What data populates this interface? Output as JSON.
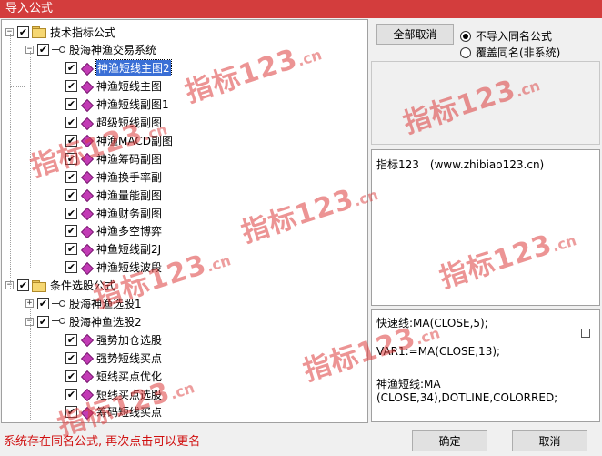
{
  "window": {
    "title": "导入公式"
  },
  "tree": {
    "items": [
      {
        "label": "技术指标公式",
        "expander": "−",
        "checked": true,
        "icon": "folder-icon",
        "selected": false
      },
      {
        "label": "股海神渔交易系统",
        "expander": "−",
        "checked": true,
        "icon": "key-icon",
        "selected": false
      },
      {
        "label": "神渔短线主图2",
        "expander": "",
        "checked": true,
        "icon": "formula-icon",
        "selected": true
      },
      {
        "label": "神渔短线主图",
        "expander": "",
        "checked": true,
        "icon": "formula-icon",
        "selected": false
      },
      {
        "label": "神渔短线副图1",
        "expander": "",
        "checked": true,
        "icon": "formula-icon",
        "selected": false
      },
      {
        "label": "超级短线副图",
        "expander": "",
        "checked": true,
        "icon": "formula-icon",
        "selected": false
      },
      {
        "label": "神渔MACD副图",
        "expander": "",
        "checked": true,
        "icon": "formula-icon",
        "selected": false
      },
      {
        "label": "神渔筹码副图",
        "expander": "",
        "checked": true,
        "icon": "formula-icon",
        "selected": false
      },
      {
        "label": "神渔换手率副",
        "expander": "",
        "checked": true,
        "icon": "formula-icon",
        "selected": false
      },
      {
        "label": "神渔量能副图",
        "expander": "",
        "checked": true,
        "icon": "formula-icon",
        "selected": false
      },
      {
        "label": "神渔财务副图",
        "expander": "",
        "checked": true,
        "icon": "formula-icon",
        "selected": false
      },
      {
        "label": "神渔多空博弈",
        "expander": "",
        "checked": true,
        "icon": "formula-icon",
        "selected": false
      },
      {
        "label": "神鱼短线副2J",
        "expander": "",
        "checked": true,
        "icon": "formula-icon",
        "selected": false
      },
      {
        "label": "神渔短线波段",
        "expander": "",
        "checked": true,
        "icon": "formula-icon",
        "selected": false
      },
      {
        "label": "条件选股公式",
        "expander": "−",
        "checked": true,
        "icon": "folder-icon",
        "selected": false
      },
      {
        "label": "股海神渔选股1",
        "expander": "+",
        "checked": true,
        "icon": "key-icon",
        "selected": false
      },
      {
        "label": "股海神鱼选股2",
        "expander": "−",
        "checked": true,
        "icon": "key-icon",
        "selected": false
      },
      {
        "label": "强势加仓选股",
        "expander": "",
        "checked": true,
        "icon": "formula-icon",
        "selected": false
      },
      {
        "label": "强势短线买点",
        "expander": "",
        "checked": true,
        "icon": "formula-icon",
        "selected": false
      },
      {
        "label": "短线买点优化",
        "expander": "",
        "checked": true,
        "icon": "formula-icon",
        "selected": false
      },
      {
        "label": "短线买点选股",
        "expander": "",
        "checked": true,
        "icon": "formula-icon",
        "selected": false
      },
      {
        "label": "筹码短线买点",
        "expander": "",
        "checked": true,
        "icon": "formula-icon",
        "selected": false
      }
    ]
  },
  "buttons": {
    "cancel_all": "全部取消",
    "ok": "确定",
    "cancel": "取消"
  },
  "options": {
    "no_import_same": "不导入同名公式",
    "overwrite_same": "覆盖同名(非系统)",
    "selected": "no_import_same"
  },
  "info": {
    "text": "指标123　(www.zhibiao123.cn)"
  },
  "code": {
    "lines": [
      "快速线:MA(CLOSE,5);",
      "VAR1:=MA(CLOSE,13);",
      "神渔短线:MA",
      "(CLOSE,34),DOTLINE,COLORRED;"
    ]
  },
  "status": {
    "message": "系统存在同名公式, 再次点击可以更名"
  },
  "watermark": {
    "text": "指标123",
    "suffix": ".cn"
  },
  "colors": {
    "titlebar": "#d33d3d",
    "selection": "#3a6fd6",
    "status_text": "#d01010",
    "watermark": "#dc3c3c"
  }
}
